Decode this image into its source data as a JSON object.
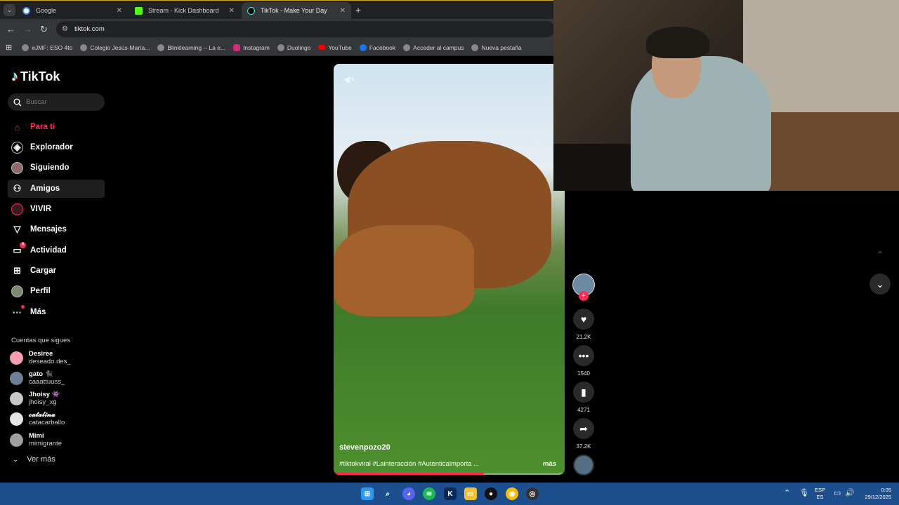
{
  "browser": {
    "tabs": [
      {
        "title": "Google",
        "icon": "google-icon",
        "color": "#4285f4"
      },
      {
        "title": "Stream - Kick Dashboard",
        "icon": "kick-icon",
        "color": "#53fc18"
      },
      {
        "title": "TikTok - Make Your Day",
        "icon": "tiktok-icon",
        "color": "#000000"
      }
    ],
    "url": "tiktok.com",
    "bookmarks": [
      {
        "label": "eJMF: ESO 4to",
        "color": "#888888"
      },
      {
        "label": "Colegio Jesús-María...",
        "color": "#888888"
      },
      {
        "label": "Blinklearning -- La e...",
        "color": "#888888"
      },
      {
        "label": "Instagram",
        "color": "#d62976"
      },
      {
        "label": "Duolingo",
        "color": "#888888"
      },
      {
        "label": "YouTube",
        "color": "#ff0000"
      },
      {
        "label": "Facebook",
        "color": "#1877f2"
      },
      {
        "label": "Acceder al campus",
        "color": "#888888"
      },
      {
        "label": "Nueva pestaña",
        "color": "#888888"
      }
    ]
  },
  "tiktok": {
    "logo": "TikTok",
    "search_placeholder": "Buscar",
    "nav": [
      {
        "label": "Para ti",
        "icon": "home-icon"
      },
      {
        "label": "Explorador",
        "icon": "compass-icon"
      },
      {
        "label": "Siguiendo",
        "icon": "following-avatar-icon"
      },
      {
        "label": "Amigos",
        "icon": "friends-icon"
      },
      {
        "label": "VIVIR",
        "icon": "live-icon"
      },
      {
        "label": "Mensajes",
        "icon": "send-icon"
      },
      {
        "label": "Actividad",
        "icon": "activity-icon",
        "badge": "4"
      },
      {
        "label": "Cargar",
        "icon": "upload-icon"
      },
      {
        "label": "Perfil",
        "icon": "profile-avatar-icon"
      },
      {
        "label": "Más",
        "icon": "more-icon"
      }
    ],
    "following_header": "Cuentas que sigues",
    "following": [
      {
        "name": "Desiree",
        "handle": "deseado.des_",
        "color": "#f4a0b0"
      },
      {
        "name": "gato 🐈‍⬛",
        "handle": "caaattuuss_",
        "color": "#6f7f96"
      },
      {
        "name": "Jhoisy 👾",
        "handle": "jhoisy_xg",
        "color": "#c9c9c9"
      },
      {
        "name": "𝓬𝓪𝓽𝓪𝓵𝓲𝓷𝓪",
        "handle": "catacarballo",
        "color": "#e6e6e6"
      },
      {
        "name": "Mimi",
        "handle": "mimigrante",
        "color": "#a0a0a0"
      }
    ],
    "see_more": "Ver más",
    "video": {
      "username": "stevenpozo20",
      "caption": "#tiktokviral #Lainteracción #Autenticalmporta ...",
      "more": "más",
      "progress": 0.65
    },
    "actions": {
      "likes": "21.2K",
      "comments": "1540",
      "saves": "4271",
      "shares": "37.2K"
    }
  },
  "taskbar": {
    "lang_top": "ESP",
    "lang_bottom": "ES",
    "time": "0:05",
    "date": "29/12/2025"
  }
}
